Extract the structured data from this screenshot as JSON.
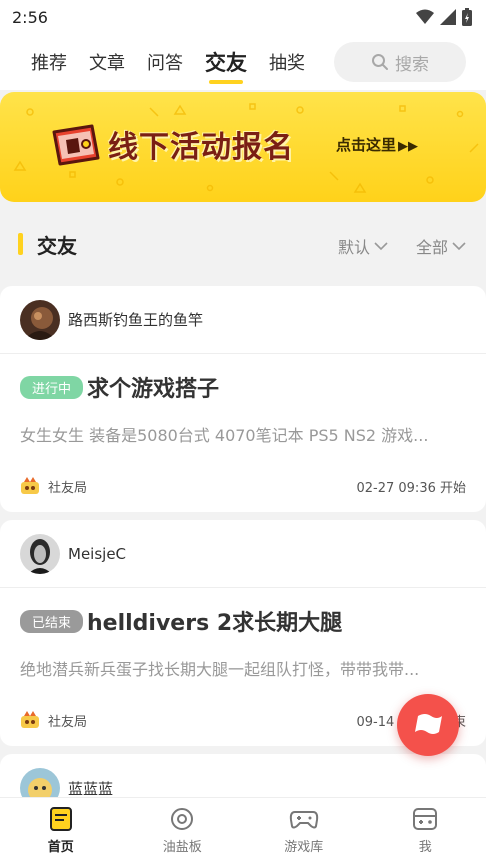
{
  "status_bar": {
    "time": "2:56"
  },
  "top_nav": {
    "tabs": [
      {
        "label": "推荐"
      },
      {
        "label": "文章"
      },
      {
        "label": "问答"
      },
      {
        "label": "交友"
      },
      {
        "label": "抽奖"
      }
    ],
    "active_tab": "交友",
    "search_label": "搜索",
    "search_icon": "search-icon"
  },
  "banner": {
    "title": "线下活动报名",
    "cta": "点击这里",
    "cta_arrows": "▶▶",
    "colors": {
      "background": "#ffd21a",
      "title": "#7a1f14"
    }
  },
  "section": {
    "title": "交友",
    "sort_filter": "默认",
    "range_filter": "全部"
  },
  "posts": [
    {
      "username": "路西斯钓鱼王的鱼竿",
      "status": "进行中",
      "title": "求个游戏搭子",
      "description": "女生女生 装备是5080台式 4070笔记本 PS5 NS2  游戏...",
      "club": "社友局",
      "time": "02-27 09:36 开始"
    },
    {
      "username": "MeisjeC",
      "status": "已结束",
      "title": "helldivers 2求长期大腿",
      "description": "绝地潜兵新兵蛋子找长期大腿一起组队打怪，带带我带...",
      "club": "社友局",
      "time": "09-14 19:00 结束"
    },
    {
      "username": "蓝蓝蓝"
    }
  ],
  "bottom_nav": {
    "items": [
      {
        "label": "首页",
        "icon": "home-doc-icon"
      },
      {
        "label": "油盐板",
        "icon": "disc-icon"
      },
      {
        "label": "游戏库",
        "icon": "gamepad-icon"
      },
      {
        "label": "我",
        "icon": "profile-console-icon"
      }
    ],
    "active": "首页"
  },
  "colors": {
    "accent": "#ffd21f",
    "fab": "#f4514b",
    "badge_ongoing": "#7fd6a4",
    "badge_ended": "#9a9a9a"
  }
}
